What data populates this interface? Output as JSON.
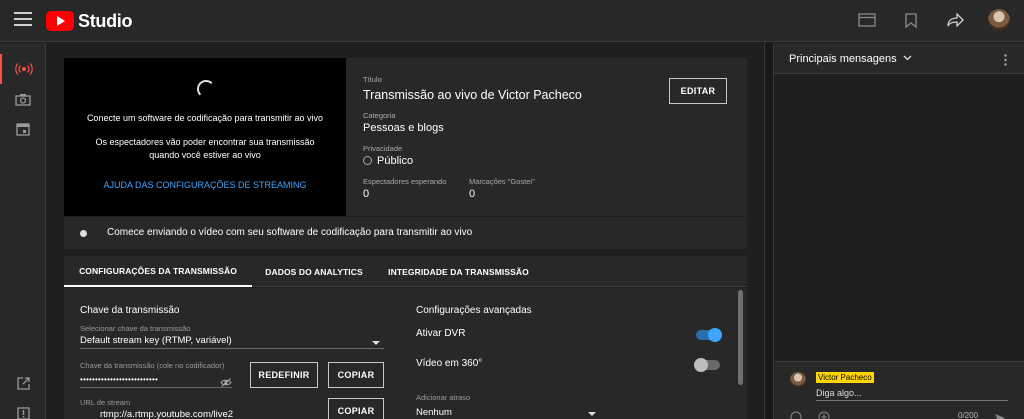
{
  "app": {
    "logo_text": "Studio"
  },
  "topbar": {
    "icons": [
      "clapperboard-icon",
      "bookmark-icon",
      "share-icon"
    ]
  },
  "leftnav": {
    "items": [
      "live-stream-icon",
      "camera-icon",
      "calendar-icon",
      "external-link-icon",
      "alert-icon"
    ]
  },
  "preview": {
    "line1": "Conecte um software de codificação para transmitir ao vivo",
    "line2a": "Os espectadores vão poder encontrar sua transmissão",
    "line2b": "quando você estiver ao vivo",
    "help_link": "AJUDA DAS CONFIGURAÇÕES DE STREAMING"
  },
  "info": {
    "title_label": "Título",
    "title_value": "Transmissão ao vivo de Victor Pacheco",
    "edit_label": "EDITAR",
    "category_label": "Categoria",
    "category_value": "Pessoas e blogs",
    "privacy_label": "Privacidade",
    "privacy_value": "Público",
    "waiting_label": "Espectadores esperando",
    "waiting_value": "0",
    "likes_label": "Marcações \"Gostei\"",
    "likes_value": "0"
  },
  "status": {
    "text": "Comece enviando o vídeo com seu software de codificação para transmitir ao vivo"
  },
  "tabs": [
    {
      "label": "CONFIGURAÇÕES DA TRANSMISSÃO"
    },
    {
      "label": "DADOS DO ANALYTICS"
    },
    {
      "label": "INTEGRIDADE DA TRANSMISSÃO"
    }
  ],
  "stream_key": {
    "section_title": "Chave da transmissão",
    "select_label": "Selecionar chave da transmissão",
    "select_value": "Default stream key (RTMP, variável)",
    "key_label": "Chave da transmissão (cole no codificador)",
    "key_value": "••••••••••••••••••••••••••",
    "reset_label": "REDEFINIR",
    "copy_label": "COPIAR",
    "url_label": "URL de stream",
    "url_value": "rtmp://a.rtmp.youtube.com/live2",
    "copy2_label": "COPIAR"
  },
  "advanced": {
    "section_title": "Configurações avançadas",
    "dvr_label": "Ativar DVR",
    "dvr_on": true,
    "v360_label": "Vídeo em 360°",
    "v360_on": false,
    "delay_label": "Adicionar atraso",
    "delay_value": "Nenhum"
  },
  "chat": {
    "title": "Principais mensagens",
    "user_name": "Victor Pacheco",
    "placeholder": "Diga algo...",
    "counter": "0/200"
  },
  "colors": {
    "accent": "#3ea6ff",
    "live_red": "#ff4e45",
    "brand_red": "#ff0000",
    "name_badge": "#ffd600"
  }
}
